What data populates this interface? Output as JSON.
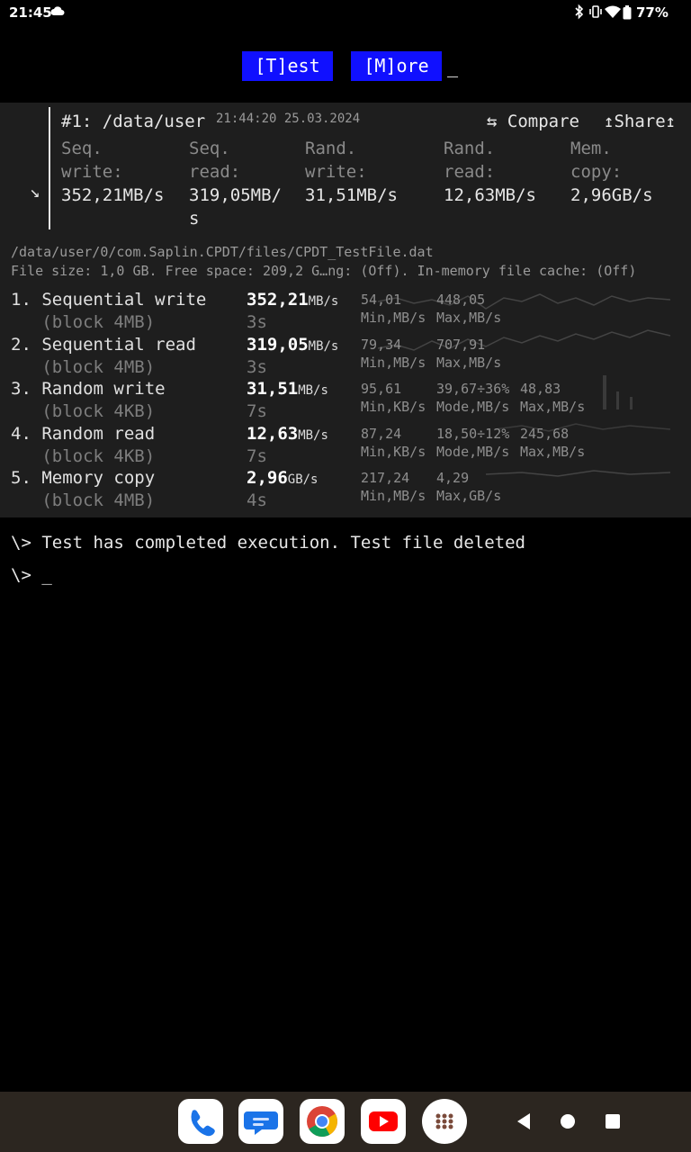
{
  "status_bar": {
    "time": "21:45",
    "battery": "77%"
  },
  "toolbar": {
    "test_label": "[T]est",
    "more_label": "[M]ore",
    "cursor": "_"
  },
  "result": {
    "title": "#1: /data/user",
    "timestamp": "21:44:20 25.03.2024",
    "compare_label": "⇆ Compare",
    "share_label": "↥Share↥",
    "expand_glyph": "↘",
    "summary": [
      {
        "label1": "Seq.",
        "label2": "write:",
        "value": "352,21MB/s"
      },
      {
        "label1": "Seq.",
        "label2": "read:",
        "value": "319,05MB/",
        "value2": "s"
      },
      {
        "label1": "Rand.",
        "label2": "write:",
        "value": "31,51MB/s"
      },
      {
        "label1": "Rand.",
        "label2": "read:",
        "value": "12,63MB/s"
      },
      {
        "label1": "Mem.",
        "label2": "copy:",
        "value": "2,96GB/s"
      }
    ],
    "path_line": "/data/user/0/com.Saplin.CPDT/files/CPDT_TestFile.dat",
    "info_line": "File size: 1,0 GB. Free space: 209,2 G…ng: (Off). In-memory file cache: (Off)"
  },
  "tests": [
    {
      "name": "1. Sequential write",
      "block": "   (block 4MB)",
      "result": "352,21",
      "unit": "MB/s",
      "time": "3s",
      "stats": [
        {
          "num": "54,01",
          "label": "Min,MB/s"
        },
        {
          "num": "448,05",
          "label": "Max,MB/s"
        }
      ]
    },
    {
      "name": "2. Sequential read",
      "block": "   (block 4MB)",
      "result": "319,05",
      "unit": "MB/s",
      "time": "3s",
      "stats": [
        {
          "num": "79,34",
          "label": "Min,MB/s"
        },
        {
          "num": "707,91",
          "label": "Max,MB/s"
        }
      ]
    },
    {
      "name": "3. Random write",
      "block": "   (block 4KB)",
      "result": "31,51",
      "unit": "MB/s",
      "time": "7s",
      "stats": [
        {
          "num": "95,61",
          "label": "Min,KB/s"
        },
        {
          "num": "39,67÷36%",
          "label": "Mode,MB/s"
        },
        {
          "num": "48,83",
          "label": "Max,MB/s"
        }
      ]
    },
    {
      "name": "4. Random read",
      "block": "   (block 4KB)",
      "result": "12,63",
      "unit": "MB/s",
      "time": "7s",
      "stats": [
        {
          "num": "87,24",
          "label": "Min,KB/s"
        },
        {
          "num": "18,50÷12%",
          "label": "Mode,MB/s"
        },
        {
          "num": "245,68",
          "label": "Max,MB/s"
        }
      ]
    },
    {
      "name": "5. Memory copy",
      "block": "   (block 4MB)",
      "result": "2,96",
      "unit": "GB/s",
      "time": "4s",
      "stats": [
        {
          "num": "217,24",
          "label": "Min,MB/s"
        },
        {
          "num": "4,29",
          "label": "Max,GB/s"
        }
      ]
    }
  ],
  "console": {
    "line1": "\\> Test has completed execution. Test file deleted",
    "line2": "\\> _"
  },
  "dock": {
    "apps": [
      "phone-icon",
      "messages-icon",
      "chrome-icon",
      "youtube-icon",
      "app-drawer-icon"
    ],
    "colors": {
      "phone": "#1a73e8",
      "messages": "#1a73e8",
      "youtube": "#ff0000",
      "nav_bg": "#2c2620"
    }
  }
}
